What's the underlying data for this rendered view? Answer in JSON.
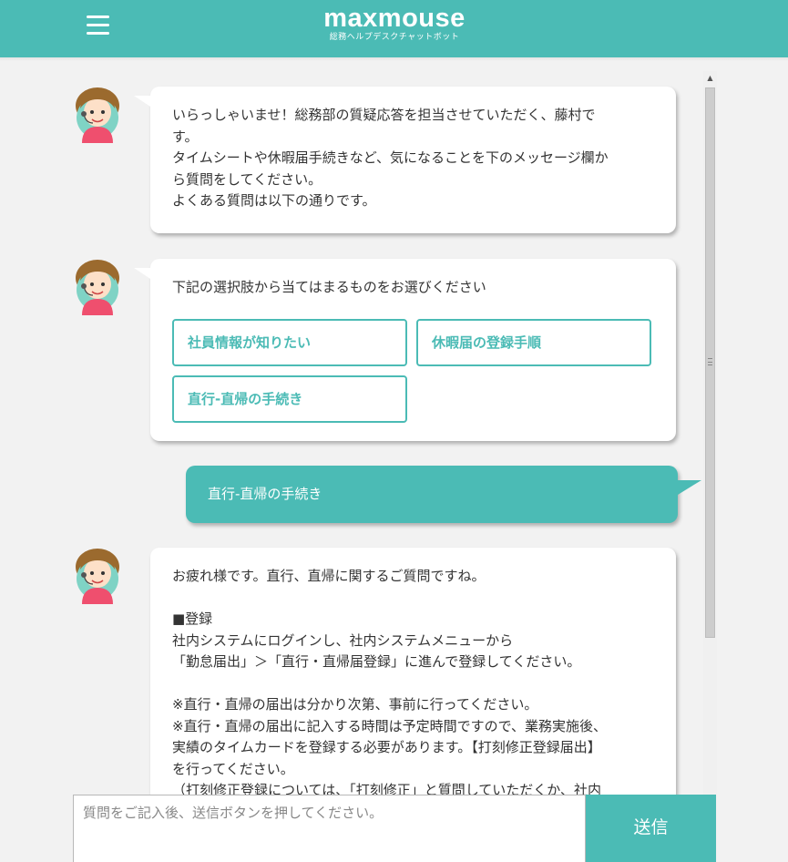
{
  "header": {
    "logo": "maxmouse",
    "subtitle": "総務ヘルプデスクチャットボット"
  },
  "messages": {
    "m1": {
      "lines": [
        "いらっしゃいませ！総務部の質疑応答を担当させていただく、藤村で",
        "す。",
        "タイムシートや休暇届手続きなど、気になることを下のメッセージ欄か",
        "ら質問をしてください。",
        "よくある質問は以下の通りです。"
      ]
    },
    "m2": {
      "prompt": "下記の選択肢から当てはまるものをお選びください",
      "choices": [
        "社員情報が知りたい",
        "休暇届の登録手順",
        "直行-直帰の手続き"
      ]
    },
    "m3": {
      "text": "直行-直帰の手続き"
    },
    "m4": {
      "lines": [
        "お疲れ様です。直行、直帰に関するご質問ですね。",
        "",
        "■登録",
        "社内システムにログインし、社内システムメニューから",
        "「勤怠届出」＞「直行・直帰届登録」に進んで登録してください。",
        "",
        "※直行・直帰の届出は分かり次第、事前に行ってください。",
        "※直行・直帰の届出に記入する時間は予定時間ですので、業務実施後、",
        "実績のタイムカードを登録する必要があります。【打刻修正登録届出】",
        "を行ってください。",
        "（打刻修正登録については、「打刻修正」と質問していただくか、社内"
      ]
    }
  },
  "input": {
    "placeholder": "質問をご記入後、送信ボタンを押してください。",
    "send_label": "送信"
  },
  "colors": {
    "accent": "#4bbbb5",
    "background": "#f2f2f2"
  }
}
